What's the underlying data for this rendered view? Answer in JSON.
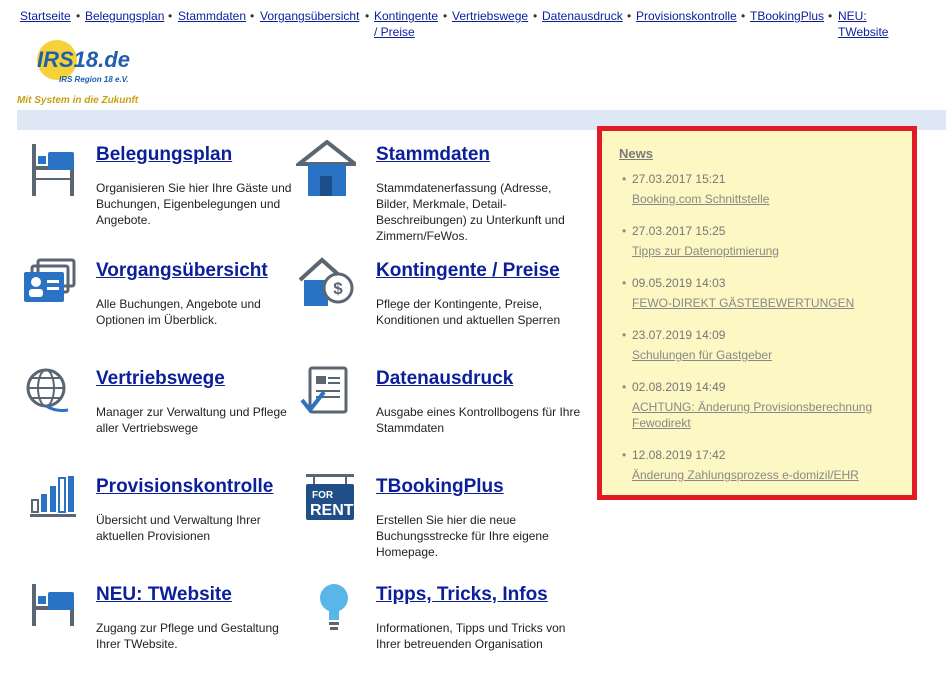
{
  "nav": {
    "items": [
      "Startseite",
      "Belegungsplan",
      "Stammdaten",
      "Vorgangsübersicht",
      "Kontingente",
      "/ Preise",
      "Vertriebswege",
      "Datenausdruck",
      "Provisionskontrolle",
      "TBookingPlus",
      "NEU:",
      "TWebsite"
    ],
    "separator": "•"
  },
  "logo": {
    "brand": "IRS18.de",
    "sub": "IRS Region 18 e.V.",
    "slogan": "Mit System in die Zukunft"
  },
  "tiles": [
    {
      "title": "Belegungsplan",
      "desc": "Organisieren Sie hier Ihre Gäste und Buchungen, Eigenbelegungen und Angebote.",
      "icon": "bed-icon"
    },
    {
      "title": "Stammdaten",
      "desc": "Stammdatenerfassung (Adresse, Bilder, Merkmale, Detail-Beschreibungen) zu Unterkunft und Zimmern/FeWos.",
      "icon": "house-icon"
    },
    {
      "title": "Vorgangsübersicht",
      "desc": "Alle Buchungen, Angebote und Optionen im Überblick.",
      "icon": "id-cards-icon"
    },
    {
      "title": "Kontingente / Preise",
      "desc": "Pflege der Kontingente, Preise, Konditionen und aktuellen Sperren",
      "icon": "house-dollar-icon"
    },
    {
      "title": "Vertriebswege",
      "desc": "Manager zur Verwaltung und Pflege aller Vertriebswege",
      "icon": "globe-icon"
    },
    {
      "title": "Datenausdruck",
      "desc": "Ausgabe eines Kontrollbogens für Ihre Stammdaten",
      "icon": "document-check-icon"
    },
    {
      "title": "Provisionskontrolle",
      "desc": "Übersicht und Verwaltung Ihrer aktuellen Provisionen",
      "icon": "bar-chart-icon"
    },
    {
      "title": "TBookingPlus",
      "desc": "Erstellen Sie hier die neue Buchungsstrecke für Ihre eigene Homepage.",
      "icon": "for-rent-sign-icon"
    },
    {
      "title": "NEU: TWebsite",
      "desc": "Zugang zur Pflege und Gestaltung Ihrer TWebsite.",
      "icon": "bed-icon"
    },
    {
      "title": "Tipps, Tricks, Infos",
      "desc": "Informationen, Tipps und Tricks von Ihrer betreuenden Organisation",
      "icon": "lightbulb-icon"
    }
  ],
  "for_rent_sign": {
    "line1": "FOR",
    "line2": "RENT"
  },
  "news": {
    "title": "News",
    "items": [
      {
        "date": "27.03.2017 15:21",
        "link": "Booking.com Schnittstelle"
      },
      {
        "date": "27.03.2017 15:25",
        "link": "Tipps zur Datenoptimierung"
      },
      {
        "date": "09.05.2019 14:03",
        "link": "FEWO-DIREKT GÄSTEBEWERTUNGEN"
      },
      {
        "date": "23.07.2019 14:09",
        "link": "Schulungen für Gastgeber"
      },
      {
        "date": "02.08.2019 14:49",
        "link": "ACHTUNG: Änderung Provisionsberechnung Fewodirekt"
      },
      {
        "date": "12.08.2019 17:42",
        "link": "Änderung Zahlungsprozess e-domizil/EHR"
      }
    ]
  },
  "colors": {
    "link": "#0b1f9a",
    "icon_blue": "#2a73c4",
    "news_bg": "#fdf7c4",
    "news_border": "#e01b24"
  }
}
